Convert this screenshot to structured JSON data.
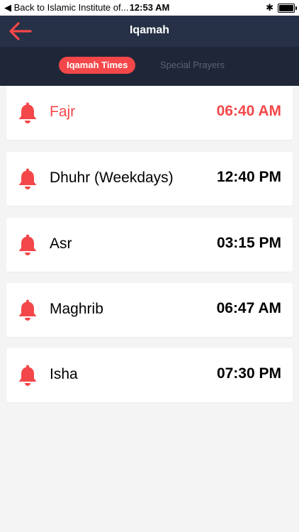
{
  "status_bar": {
    "back_label": "◀ Back to Islamic Institute of...",
    "time": "12:53 AM",
    "bluetooth_glyph": "✱"
  },
  "nav": {
    "title": "Iqamah",
    "back_icon": "back-arrow-icon",
    "back_color": "#f44749"
  },
  "tabs": [
    {
      "label": "Iqamah Times",
      "active": true
    },
    {
      "label": "Special Prayers",
      "active": false
    }
  ],
  "prayers": [
    {
      "name": "Fajr",
      "time": "06:40 AM",
      "highlighted": true
    },
    {
      "name": "Dhuhr (Weekdays)",
      "time": "12:40 PM",
      "highlighted": false
    },
    {
      "name": "Asr",
      "time": "03:15 PM",
      "highlighted": false
    },
    {
      "name": "Maghrib",
      "time": "06:47 AM",
      "highlighted": false
    },
    {
      "name": "Isha",
      "time": "07:30 PM",
      "highlighted": false
    }
  ],
  "colors": {
    "accent": "#f44749",
    "nav_bg": "#263147",
    "segment_bg": "#1f2638",
    "content_bg": "#f4f4f4"
  }
}
